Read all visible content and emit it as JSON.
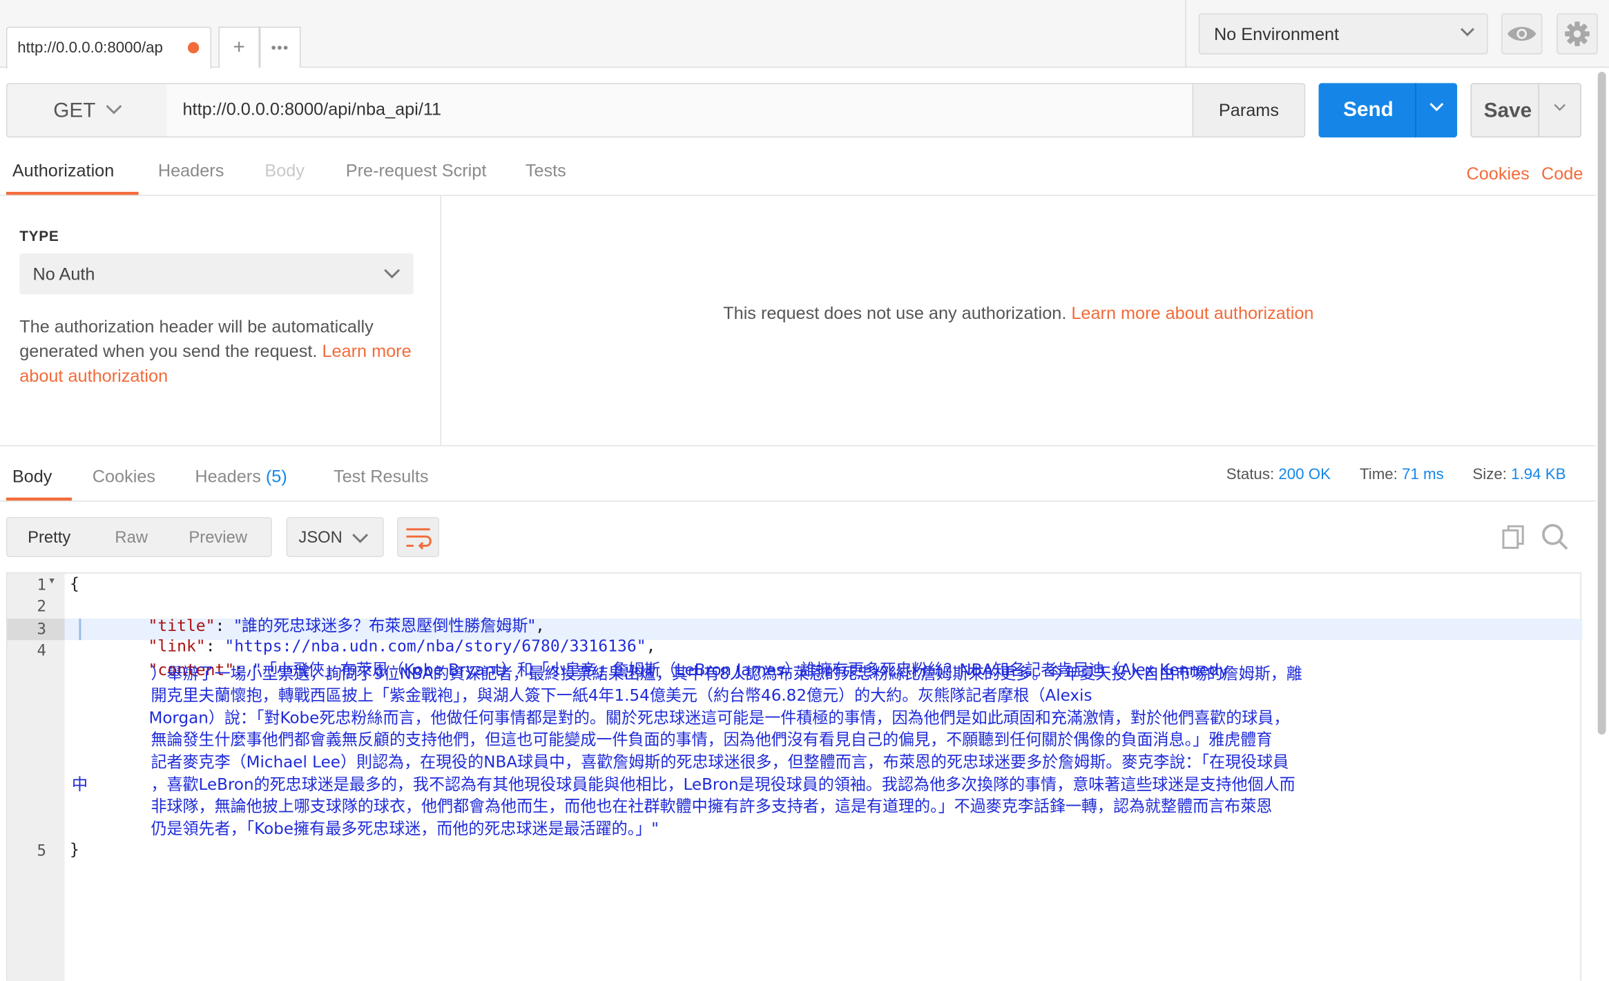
{
  "tabs": {
    "active_label": "http://0.0.0.0:8000/ap",
    "new_tab_symbol": "+",
    "more_symbol": "•••"
  },
  "environment": {
    "selected": "No Environment"
  },
  "request": {
    "method": "GET",
    "url": "http://0.0.0.0:8000/api/nba_api/11",
    "params_label": "Params",
    "send_label": "Send",
    "save_label": "Save"
  },
  "request_tabs": [
    "Authorization",
    "Headers",
    "Body",
    "Pre-request Script",
    "Tests"
  ],
  "request_links": {
    "cookies": "Cookies",
    "code": "Code"
  },
  "auth": {
    "type_label": "TYPE",
    "type_value": "No Auth",
    "description": "The authorization header will be automatically generated when you send the request.",
    "learn_more": "Learn more about authorization",
    "message": "This request does not use any authorization.",
    "message_link": "Learn more about authorization"
  },
  "response_tabs": {
    "body": "Body",
    "cookies": "Cookies",
    "headers": "Headers",
    "headers_count": "(5)",
    "test_results": "Test Results"
  },
  "response_status": {
    "status_label": "Status:",
    "status_value": "200 OK",
    "time_label": "Time:",
    "time_value": "71 ms",
    "size_label": "Size:",
    "size_value": "1.94 KB"
  },
  "body_formats": [
    "Pretty",
    "Raw",
    "Preview"
  ],
  "body_language": "JSON",
  "code": {
    "line_numbers": [
      "1",
      "2",
      "3",
      "4",
      "5"
    ],
    "open_brace": "{",
    "close_brace": "}",
    "title_key": "\"title\"",
    "title_value": "\"誰的死忠球迷多？布萊恩壓倒性勝詹姆斯\"",
    "link_key": "\"link\"",
    "link_value": "\"https://nba.udn.com/nba/story/6780/3316136\"",
    "content_key": "\"content\"",
    "content_lines": [
      "\"「小飛俠」布萊恩（Kobe Bryant）和「小皇帝」詹姆斯（LeBron James）誰擁有更多死忠粉絲？NBA知名記者肯尼迪（Alex Kennedy",
      "）舉辦了一場小型票選，詢問了9位NBA的資深記者，最終投票結果出爐，其中有8人認為布萊恩的死忠粉絲比詹姆斯來的更多。今年夏天投入自由市場的詹姆斯，離",
      "開克里夫蘭懷抱，轉戰西區披上「紫金戰袍」，與湖人簽下一紙4年1.54億美元（約台幣46.82億元）的大約。灰熊隊記者摩根（Alexis",
      "Morgan）說：「對Kobe死忠粉絲而言，他做任何事情都是對的。關於死忠球迷這可能是一件積極的事情，因為他們是如此頑固和充滿激情，對於他們喜歡的球員，",
      "無論發生什麼事他們都會義無反顧的支持他們，但這也可能變成一件負面的事情，因為他們沒有看見自己的偏見，不願聽到任何關於偶像的負面消息。」雅虎體育",
      "記者麥克李（Michael Lee）則認為，在現役的NBA球員中，喜歡詹姆斯的死忠球迷很多，但整體而言，布萊恩的死忠球迷要多於詹姆斯。麥克李說：「在現役球員",
      "，喜歡LeBron的死忠球迷是最多的，我不認為有其他現役球員能與他相比，LeBron是現役球員的領袖。我認為他多次換隊的事情，意味著這些球迷是支持他個人而",
      "非球隊，無論他披上哪支球隊的球衣，他們都會為他而生，而他也在社群軟體中擁有許多支持者，這是有道理的。」不過麥克李話鋒一轉，認為就整體而言布萊恩",
      "仍是領先者，「Kobe擁有最多死忠球迷，而他的死忠球迷是最活躍的。」\""
    ],
    "stray_char": "中"
  }
}
